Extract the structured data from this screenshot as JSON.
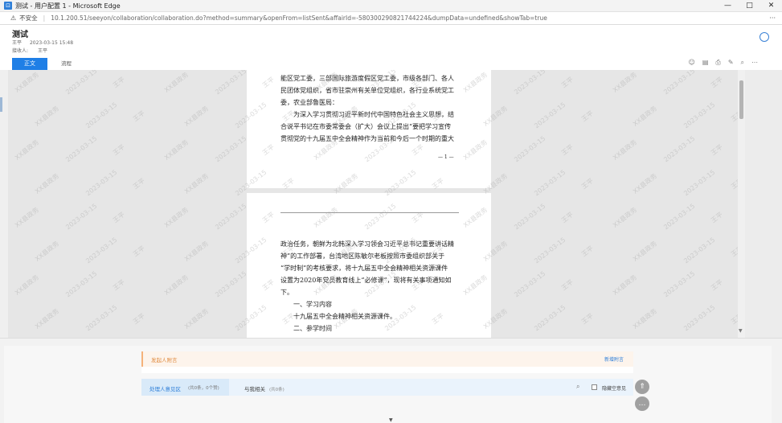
{
  "window": {
    "title": "测试 - 用户配置 1 - Microsoft Edge",
    "controls": [
      "—",
      "□",
      "✕"
    ]
  },
  "address": {
    "warning": "不安全",
    "url": "10.1.200.51/seeyon/collaboration/collaboration.do?method=summary&openFrom=listSent&affairId=-580300290821744224&dumpData=undefined&showTab=true",
    "more": "···"
  },
  "header": {
    "title": "测试",
    "author": "王平",
    "datetime": "2023-03-15 15:48",
    "recipients_label": "接收人:",
    "recipients_value": "王平",
    "tab_main": "正文",
    "tab_flow": "流程"
  },
  "tools": [
    "☺",
    "▤",
    "⎙",
    "✎",
    "⌕",
    "⋯"
  ],
  "document": {
    "page1_lines": [
      "能区党工委，三部国际旅游度假区党工委，市级各部门、各人",
      "民团体党组织，省市驻崇州有关单位党组织，各行业系统党工",
      "委，农业部鲁医局：",
      "　　为深入学习贯彻习近平新时代中国特色社会主义思想，结",
      "合说平书记在市委常委会（扩大）会议上提出“要把学习宣传",
      "贯彻党的十九届五中全会精神作为当前和今后一个时期的重大"
    ],
    "page1_number": "— 1 —",
    "page2_lines": [
      "政治任务，朝鲜为北韩深入学习领会习近平总书记重要讲话精",
      "神”的工作部署，台湾地区陈敏尔老板按照市委组织部关于",
      "“学时制”的考核要求，将十九届五中全会精神相关资源课件",
      "设置为2020年党员教育线上“必修课”，现将有关事项通知如",
      "下。",
      "　　一、学习内容",
      "　　十九届五中全会精神相关资源课件。",
      "　　二、参学时间"
    ],
    "watermark": [
      "XX县政务",
      "2023-03-15",
      "王平"
    ]
  },
  "bottom": {
    "sender_label": "发起人附言",
    "add_attachment": "新增附言",
    "handle_tab": "处理人意见区",
    "handle_count": "(共0条，0个赞)",
    "related_tab": "与我相关",
    "related_count": "(共0条)",
    "hide_opinion": "隐藏空意见",
    "fab_top": "⇑",
    "fab_chat": "…"
  }
}
